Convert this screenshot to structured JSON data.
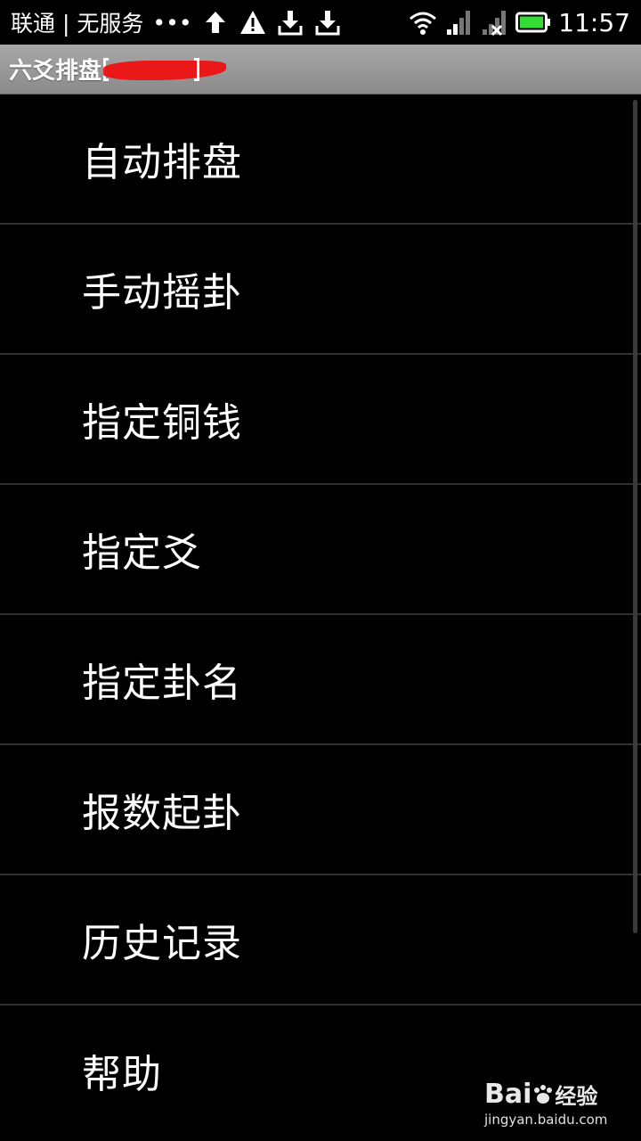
{
  "status_bar": {
    "carrier": "联通 | 无服务",
    "dots": "•••",
    "time": "11:57",
    "icons": [
      "upload-arrow-icon",
      "warning-icon",
      "download-icon",
      "download-icon",
      "wifi-icon",
      "signal-icon",
      "signal-off-icon",
      "battery-icon"
    ],
    "battery_color": "#33dd33"
  },
  "app": {
    "title": "六爻排盘"
  },
  "menu": {
    "items": [
      {
        "label": "自动排盘"
      },
      {
        "label": "手动摇卦"
      },
      {
        "label": "指定铜钱"
      },
      {
        "label": "指定爻"
      },
      {
        "label": "指定卦名"
      },
      {
        "label": "报数起卦"
      },
      {
        "label": "历史记录"
      },
      {
        "label": "帮助"
      }
    ]
  },
  "watermark": {
    "logo": "Bai",
    "logo_suffix": "经验",
    "url": "jingyan.baidu.com"
  }
}
